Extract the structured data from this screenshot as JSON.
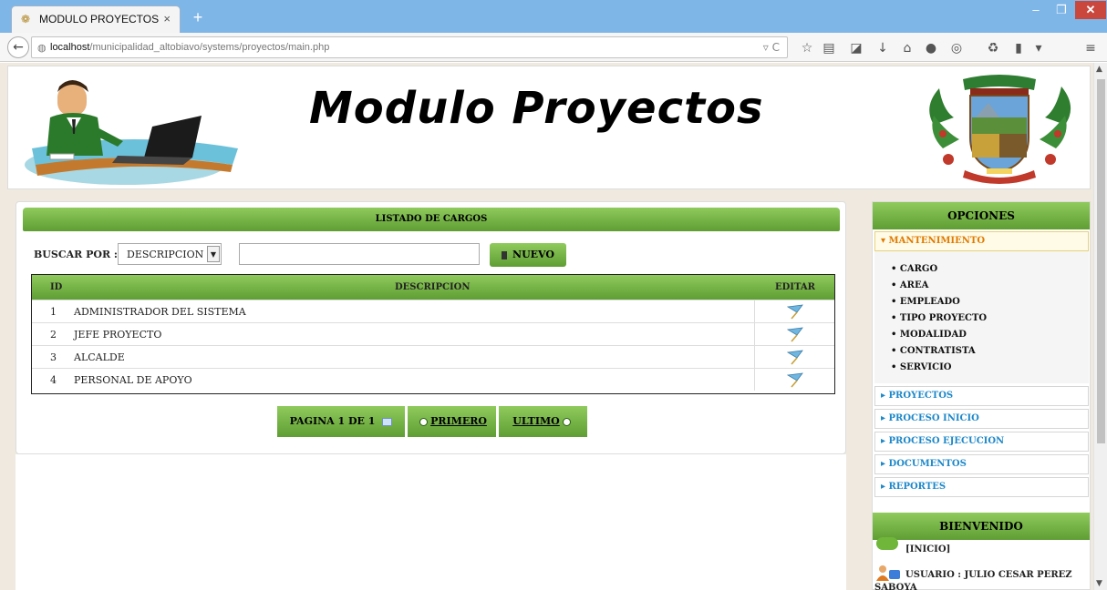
{
  "browser": {
    "tab_title": "MODULO PROYECTOS",
    "tab_close": "×",
    "new_tab": "+",
    "url_host": "localhost",
    "url_path": "/municipalidad_altobiavo/systems/proyectos/main.php",
    "window_controls": {
      "minimize": "–",
      "maximize": "❐",
      "close": "✕"
    }
  },
  "header": {
    "title": "Modulo Proyectos",
    "left_image": "office-worker-laptop-illustration",
    "right_image": "municipal-coat-of-arms"
  },
  "listado": {
    "title": "LISTADO DE CARGOS",
    "search_label": "BUSCAR POR :",
    "search_field_selected": "DESCRIPCION",
    "search_value": "",
    "nuevo_label": "NUEVO",
    "columns": {
      "id": "ID",
      "descripcion": "DESCRIPCION",
      "editar": "EDITAR"
    },
    "rows": [
      {
        "id": "1",
        "descripcion": "ADMINISTRADOR DEL SISTEMA"
      },
      {
        "id": "2",
        "descripcion": "JEFE PROYECTO"
      },
      {
        "id": "3",
        "descripcion": "ALCALDE"
      },
      {
        "id": "4",
        "descripcion": "PERSONAL DE APOYO"
      }
    ],
    "pager": {
      "page_info": "PAGINA 1 DE 1",
      "first": "PRIMERO",
      "last": "ULTIMO"
    }
  },
  "sidebar": {
    "title": "OPCIONES",
    "open_section": "MANTENIMIENTO",
    "open_items": [
      "CARGO",
      "AREA",
      "EMPLEADO",
      "TIPO PROYECTO",
      "MODALIDAD",
      "CONTRATISTA",
      "SERVICIO"
    ],
    "sections": [
      "PROYECTOS",
      "PROCESO INICIO",
      "PROCESO EJECUCION",
      "DOCUMENTOS",
      "REPORTES"
    ],
    "welcome_title": "BIENVENIDO",
    "inicio": "[INICIO]",
    "usuario_line1": "USUARIO : JULIO CESAR PEREZ",
    "usuario_line2": "SABOYA"
  },
  "colors": {
    "accent_green": "#6cab40",
    "link_blue": "#1e88c9",
    "active_orange": "#e07a00"
  }
}
